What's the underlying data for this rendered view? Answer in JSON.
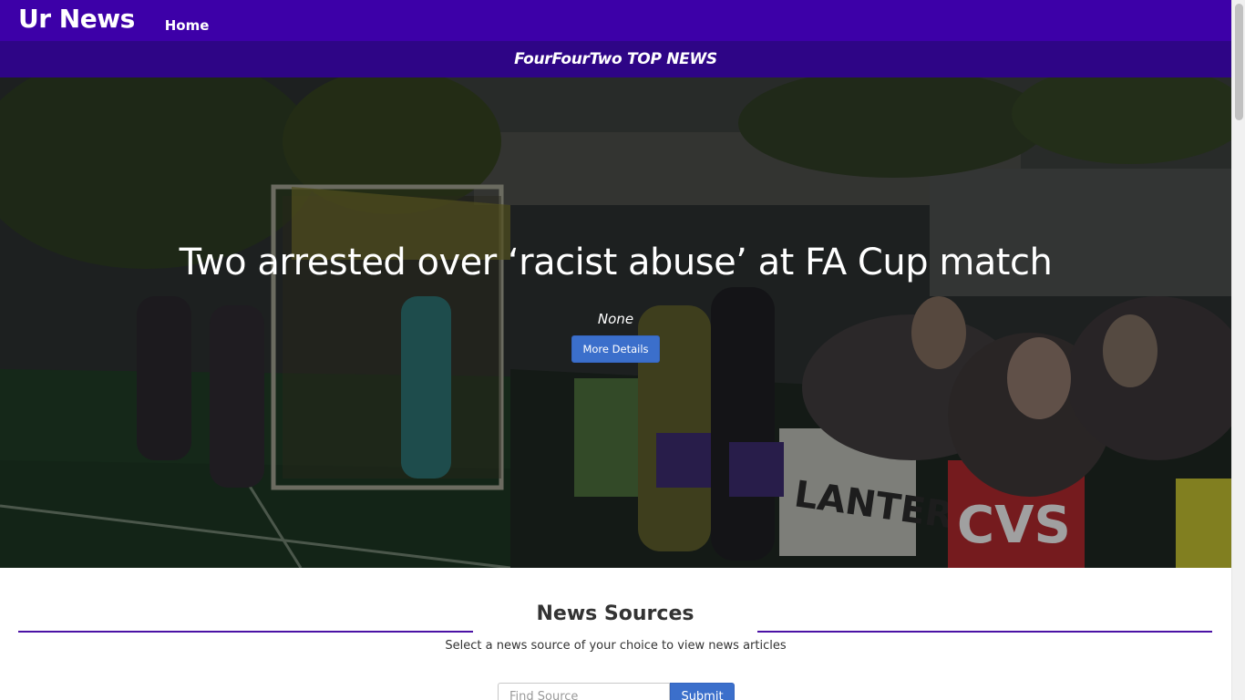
{
  "navbar": {
    "brand": "Ur News",
    "home_label": "Home",
    "background_color": "#3d00a8"
  },
  "subheader": {
    "title": "FourFourTwo TOP NEWS",
    "background_color": "#2e0586"
  },
  "hero": {
    "headline": "Two arrested over ‘racist abuse’ at FA Cup match",
    "description": "None",
    "button_label": "More Details",
    "image_subject": "football-match-crowd-photo"
  },
  "sources": {
    "title": "News Sources",
    "subtitle": "Select a news source of your choice to view news articles",
    "search_placeholder": "Find Source",
    "search_value": "",
    "submit_label": "Submit",
    "accent_color": "#4b12a5"
  },
  "colors": {
    "button": "#3b6fcb"
  }
}
